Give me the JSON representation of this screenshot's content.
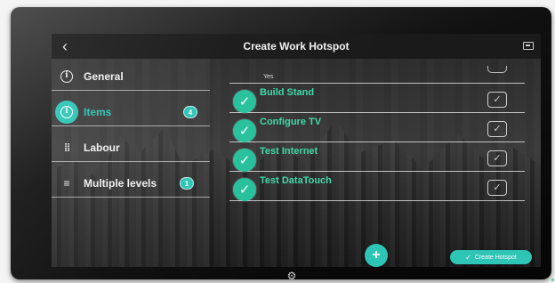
{
  "window": {
    "title": "Create Work Hotspot",
    "back_icon": "chevron-left-icon",
    "window_icon": "window-icon"
  },
  "sidebar": {
    "items": [
      {
        "label": "General",
        "icon": "info-circle-icon",
        "badge": ""
      },
      {
        "label": "Items",
        "icon": "info-circle-icon",
        "badge": "4",
        "active": true
      },
      {
        "label": "Labour",
        "icon": "labour-icon",
        "badge": ""
      },
      {
        "label": "Multiple levels",
        "icon": "menu-icon",
        "badge": "1"
      }
    ]
  },
  "list": {
    "header_label": "Yes",
    "rows": [
      {
        "label": "Build Stand",
        "checked": true
      },
      {
        "label": "Configure TV",
        "checked": true
      },
      {
        "label": "Test Internet",
        "checked": true
      },
      {
        "label": "Test DataTouch",
        "checked": true
      }
    ]
  },
  "actions": {
    "add_label": "+",
    "create_label": "Create Hotspot"
  },
  "colors": {
    "accent": "#2ec4b6",
    "check_green": "#27c09c",
    "row_text": "#3fd9a8"
  }
}
